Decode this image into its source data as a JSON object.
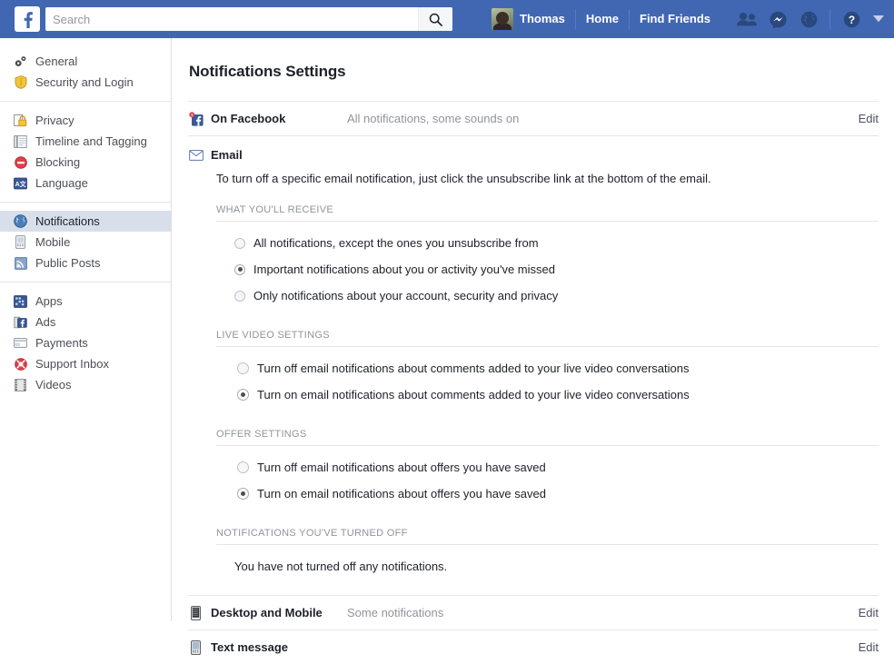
{
  "topbar": {
    "logo_icon": "facebook-logo-icon",
    "search": {
      "placeholder": "Search",
      "value": "",
      "icon": "search-icon"
    },
    "profile_name": "Thomas",
    "home_label": "Home",
    "find_friends_label": "Find Friends",
    "icons": [
      {
        "name": "friend-requests-icon"
      },
      {
        "name": "messenger-icon"
      },
      {
        "name": "notifications-globe-icon"
      },
      {
        "name": "help-icon"
      },
      {
        "name": "account-menu-caret-icon"
      }
    ],
    "bar_color": "#4267b2"
  },
  "sidebar": {
    "groups": [
      {
        "items": [
          {
            "label": "General",
            "icon": "gears-icon",
            "selected": false
          },
          {
            "label": "Security and Login",
            "icon": "shield-icon",
            "selected": false
          }
        ]
      },
      {
        "items": [
          {
            "label": "Privacy",
            "icon": "lock-icon",
            "selected": false
          },
          {
            "label": "Timeline and Tagging",
            "icon": "timeline-icon",
            "selected": false
          },
          {
            "label": "Blocking",
            "icon": "block-icon",
            "selected": false
          },
          {
            "label": "Language",
            "icon": "language-icon",
            "selected": false
          }
        ]
      },
      {
        "items": [
          {
            "label": "Notifications",
            "icon": "globe-icon",
            "selected": true
          },
          {
            "label": "Mobile",
            "icon": "mobile-icon",
            "selected": false
          },
          {
            "label": "Public Posts",
            "icon": "rss-icon",
            "selected": false
          }
        ]
      },
      {
        "items": [
          {
            "label": "Apps",
            "icon": "apps-icon",
            "selected": false
          },
          {
            "label": "Ads",
            "icon": "ads-icon",
            "selected": false
          },
          {
            "label": "Payments",
            "icon": "payments-card-icon",
            "selected": false
          },
          {
            "label": "Support Inbox",
            "icon": "lifebuoy-icon",
            "selected": false
          },
          {
            "label": "Videos",
            "icon": "film-icon",
            "selected": false
          }
        ]
      }
    ],
    "selected_bg": "#d8dfea"
  },
  "main": {
    "page_title": "Notifications Settings",
    "on_facebook": {
      "icon": "facebook-badge-icon",
      "label": "On Facebook",
      "value": "All notifications, some sounds on",
      "edit_label": "Edit"
    },
    "email": {
      "icon": "envelope-icon",
      "label": "Email",
      "description": "To turn off a specific email notification, just click the unsubscribe link at the bottom of the email.",
      "sections": [
        {
          "title": "WHAT YOU'LL RECEIVE",
          "options": [
            {
              "label": "All notifications, except the ones you unsubscribe from",
              "checked": false
            },
            {
              "label": "Important notifications about you or activity you've missed",
              "checked": true
            },
            {
              "label": "Only notifications about your account, security and privacy",
              "checked": false
            }
          ]
        },
        {
          "title": "LIVE VIDEO SETTINGS",
          "options": [
            {
              "label": "Turn off email notifications about comments added to your live video conversations",
              "checked": false
            },
            {
              "label": "Turn on email notifications about comments added to your live video conversations",
              "checked": true
            }
          ]
        },
        {
          "title": "OFFER SETTINGS",
          "options": [
            {
              "label": "Turn off email notifications about offers you have saved",
              "checked": false
            },
            {
              "label": "Turn on email notifications about offers you have saved",
              "checked": true
            }
          ]
        }
      ],
      "turned_off": {
        "title": "NOTIFICATIONS YOU'VE TURNED OFF",
        "note": "You have not turned off any notifications."
      }
    },
    "desktop_mobile": {
      "icon": "desktop-mobile-icon",
      "label": "Desktop and Mobile",
      "value": "Some notifications",
      "edit_label": "Edit"
    },
    "text_message": {
      "icon": "phone-icon",
      "label": "Text message",
      "value": "",
      "edit_label": "Edit"
    }
  }
}
